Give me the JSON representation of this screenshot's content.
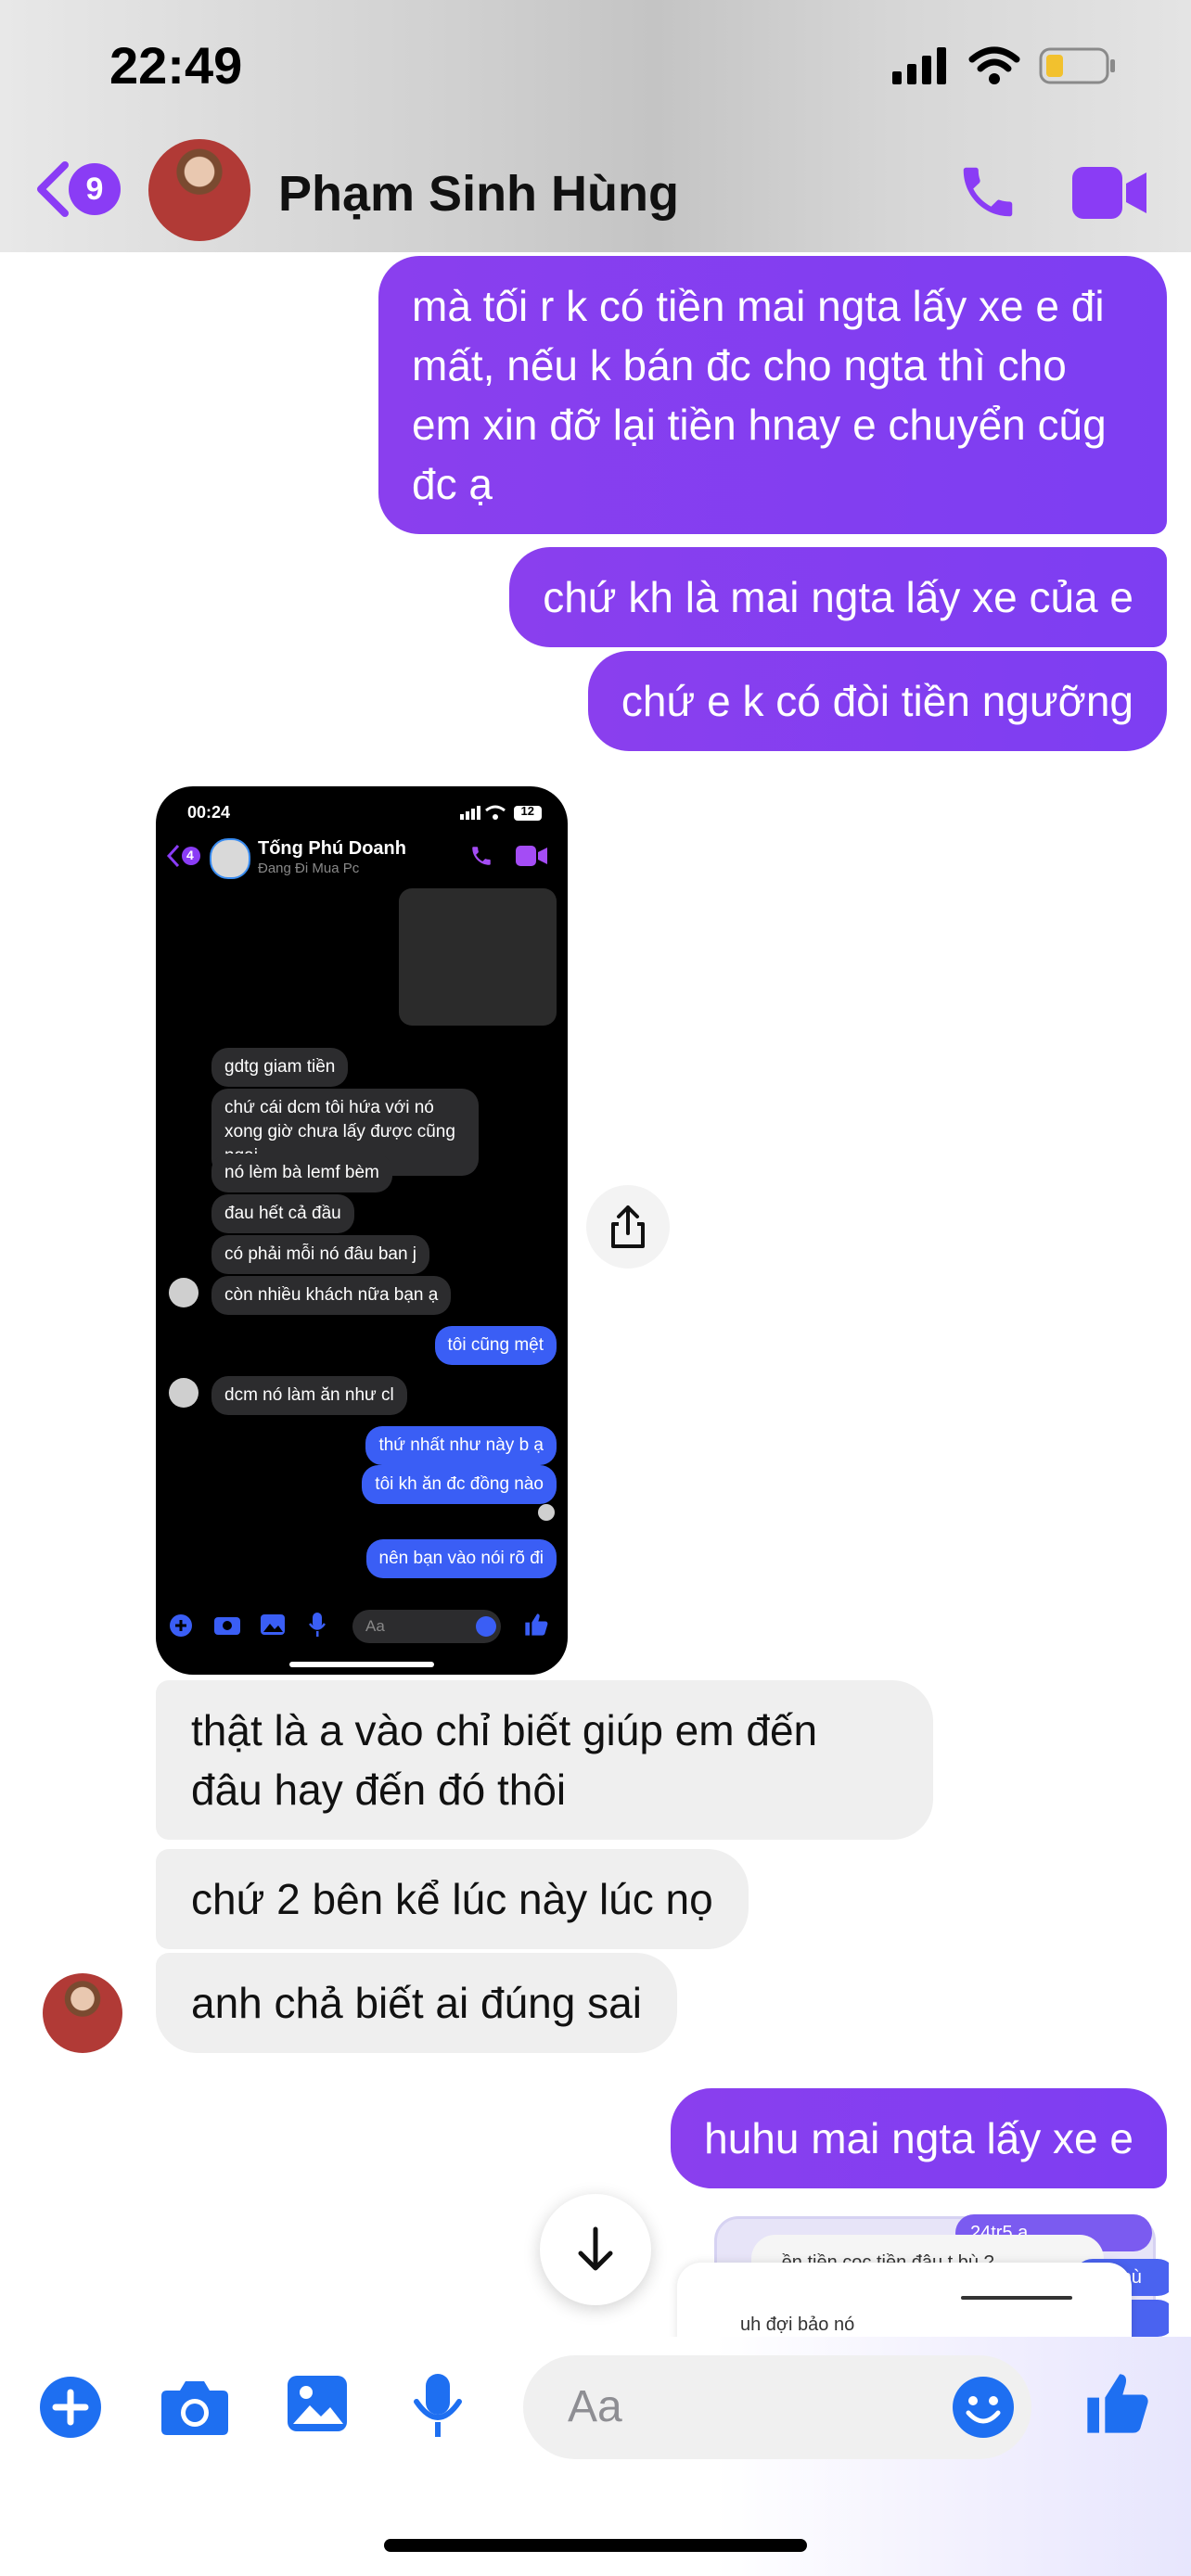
{
  "status_bar": {
    "time": "22:49"
  },
  "header": {
    "back_count": "9",
    "contact_name": "Phạm Sinh Hùng"
  },
  "messages_top": [
    "mà tối r k có tiền mai ngta lấy xe e đi mất, nếu k bán đc cho ngta thì cho em xin đỡ lại tiền hnay e chuyển cũg đc ạ",
    "chứ kh là mai ngta lấy xe của e",
    "chứ e k có đòi tiền ngưỡng"
  ],
  "screenshot": {
    "time": "00:24",
    "battery": "12",
    "back_count": "4",
    "name": "Tống Phú Doanh",
    "subtitle": "Đang Đi Mua Pc",
    "bubbles": [
      "gdtg giam tiền",
      "chứ cái dcm tôi hứa với nó xong giờ chưa lấy được cũng ngại",
      "nó lèm bà lemf bèm",
      "đau hết cả đầu",
      "có phải mỗi nó đâu ban j",
      "còn nhiều khách nữa bạn ạ",
      "tôi cũng mệt",
      "dcm nó làm ăn như cl",
      "thứ nhất như này b ạ",
      "tôi kh ăn đc đồng nào",
      "nên bạn vào nói rõ đi"
    ],
    "input_placeholder": "Aa"
  },
  "messages_in": [
    "thật là a vào chỉ biết giúp em đến đâu hay đến đó thôi",
    "chứ 2 bên kể lúc này lúc nọ",
    "anh chả biết ai đúng sai"
  ],
  "messages_bottom": [
    "huhu mai ngta lấy xe e"
  ],
  "preview_text": [
    "24tr5 a",
    "...ền tiền cọc tiền đâu t bù ?",
    "uh đợi bảo nó",
    "xe bù",
    "ta"
  ],
  "composer": {
    "placeholder": "Aa"
  },
  "colors": {
    "accent": "#8a3cf5",
    "outgoing": "#7d3ef2",
    "incoming": "#efefef",
    "blue_icon": "#1e6ff1"
  }
}
